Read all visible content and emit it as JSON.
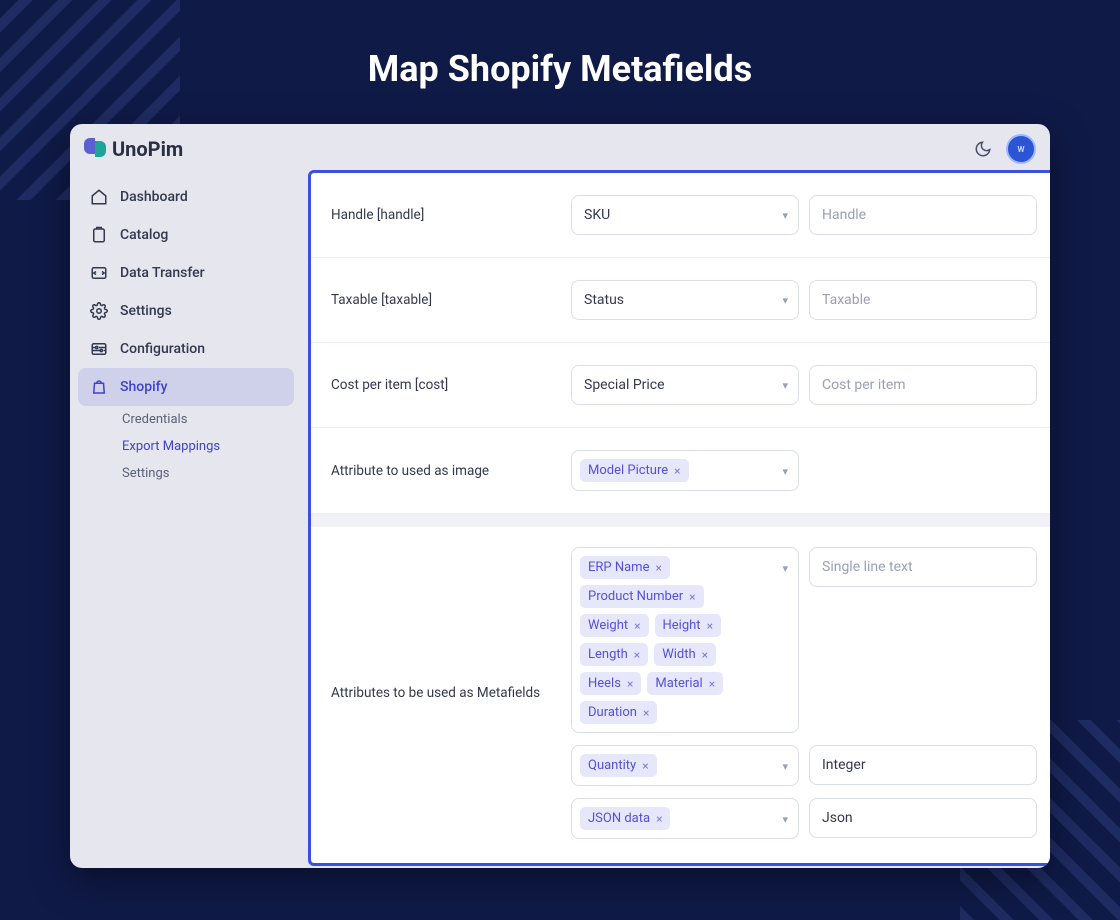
{
  "hero": {
    "title": "Map Shopify Metafields"
  },
  "brand": {
    "name": "UnoPim"
  },
  "avatar": {
    "text": "W"
  },
  "sidebar": {
    "items": [
      {
        "label": "Dashboard",
        "name": "dashboard"
      },
      {
        "label": "Catalog",
        "name": "catalog"
      },
      {
        "label": "Data Transfer",
        "name": "data-transfer"
      },
      {
        "label": "Settings",
        "name": "settings"
      },
      {
        "label": "Configuration",
        "name": "configuration"
      },
      {
        "label": "Shopify",
        "name": "shopify"
      }
    ],
    "shopify_sub": [
      {
        "label": "Credentials"
      },
      {
        "label": "Export Mappings"
      },
      {
        "label": "Settings"
      }
    ]
  },
  "fields": {
    "handle": {
      "label": "Handle [handle]",
      "select": "SKU",
      "placeholder": "Handle"
    },
    "taxable": {
      "label": "Taxable [taxable]",
      "select": "Status",
      "placeholder": "Taxable"
    },
    "cost": {
      "label": "Cost per item [cost]",
      "select": "Special Price",
      "placeholder": "Cost per item"
    },
    "image": {
      "label": "Attribute to used as image",
      "chips": [
        "Model Picture"
      ]
    }
  },
  "metafields": {
    "label": "Attributes to be used as Metafields",
    "rows": [
      {
        "chips": [
          "ERP Name",
          "Product Number",
          "Weight",
          "Height",
          "Length",
          "Width",
          "Heels",
          "Material",
          "Duration"
        ],
        "type_placeholder": "Single line text",
        "type_value": ""
      },
      {
        "chips": [
          "Quantity"
        ],
        "type_value": "Integer"
      },
      {
        "chips": [
          "JSON data"
        ],
        "type_value": "Json"
      }
    ]
  }
}
